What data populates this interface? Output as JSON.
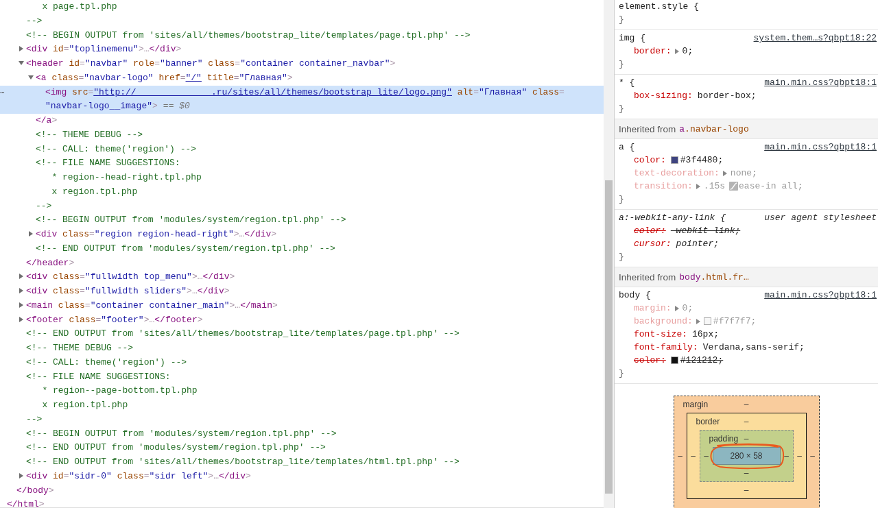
{
  "dom": [
    {
      "kind": "element",
      "close": "</html>",
      "children": [
        {
          "kind": "element",
          "close": "</body>",
          "children": [
            {
              "kind": "comment",
              "selected": false,
              "lines": [
                "   x page.tpl.php",
                "-->"
              ]
            },
            {
              "kind": "comment",
              "selected": false,
              "lines": [
                "<!-- BEGIN OUTPUT from 'sites/all/themes/bootstrap_lite/templates/page.tpl.php' -->"
              ]
            },
            {
              "kind": "element",
              "open": "<div id=\"toplinemenu\">…</div>",
              "expanded": false,
              "selected": false
            },
            {
              "kind": "element",
              "open": "<header id=\"navbar\" role=\"banner\" class=\"container container_navbar\">",
              "expanded": true,
              "selected": false,
              "close": "</header>",
              "children": [
                {
                  "kind": "element",
                  "open": [
                    {
                      "text": "<a class=\"navbar-logo\" href=",
                      "link": false
                    },
                    {
                      "text": "\"/\"",
                      "link": true
                    },
                    {
                      "text": " title=\"Главная\">",
                      "link": false
                    }
                  ],
                  "expanded": true,
                  "selected": false,
                  "close": "</a>",
                  "children": [
                    {
                      "kind": "element",
                      "open": [
                        {
                          "text": "<img src=",
                          "link": false
                        },
                        {
                          "text": "\"http://              .ru/sites/all/themes/bootstrap_lite/logo.png\"",
                          "link": true
                        },
                        {
                          "text": " alt=\"Главная\" class=",
                          "link": false
                        },
                        {
                          "text": "\"navbar-logo__image\">",
                          "link": false
                        }
                      ],
                      "selected": true,
                      "gutter": "⋯",
                      "reference": "== $0"
                    }
                  ]
                },
                {
                  "kind": "comment",
                  "selected": false,
                  "lines": [
                    "<!-- THEME DEBUG -->"
                  ]
                },
                {
                  "kind": "comment",
                  "selected": false,
                  "lines": [
                    "<!-- CALL: theme('region') -->"
                  ]
                },
                {
                  "kind": "comment",
                  "selected": false,
                  "lines": [
                    "<!-- FILE NAME SUGGESTIONS:",
                    "   * region--head-right.tpl.php",
                    "   x region.tpl.php",
                    "-->"
                  ]
                },
                {
                  "kind": "comment",
                  "selected": false,
                  "lines": [
                    "<!-- BEGIN OUTPUT from 'modules/system/region.tpl.php' -->"
                  ]
                },
                {
                  "kind": "element",
                  "open": "<div class=\"region region-head-right\">…</div>",
                  "expanded": false,
                  "selected": false
                },
                {
                  "kind": "comment",
                  "selected": false,
                  "lines": [
                    "<!-- END OUTPUT from 'modules/system/region.tpl.php' -->"
                  ]
                }
              ]
            },
            {
              "kind": "element",
              "open": "<div class=\"fullwidth top_menu\">…</div>",
              "expanded": false,
              "selected": false
            },
            {
              "kind": "element",
              "open": "<div class=\"fullwidth sliders\">…</div>",
              "expanded": false,
              "selected": false
            },
            {
              "kind": "element",
              "open": "<main class=\"container container_main\">…</main>",
              "expanded": false,
              "selected": false
            },
            {
              "kind": "element",
              "open": "<footer class=\"footer\">…</footer>",
              "expanded": false,
              "selected": false
            },
            {
              "kind": "comment",
              "selected": false,
              "lines": [
                "<!-- END OUTPUT from 'sites/all/themes/bootstrap_lite/templates/page.tpl.php' -->"
              ]
            },
            {
              "kind": "comment",
              "selected": false,
              "lines": [
                "<!-- THEME DEBUG -->"
              ]
            },
            {
              "kind": "comment",
              "selected": false,
              "lines": [
                "<!-- CALL: theme('region') -->"
              ]
            },
            {
              "kind": "comment",
              "selected": false,
              "lines": [
                "<!-- FILE NAME SUGGESTIONS:",
                "   * region--page-bottom.tpl.php",
                "   x region.tpl.php",
                "-->"
              ]
            },
            {
              "kind": "comment",
              "selected": false,
              "lines": [
                "<!-- BEGIN OUTPUT from 'modules/system/region.tpl.php' -->"
              ]
            },
            {
              "kind": "comment",
              "selected": false,
              "lines": [
                "<!-- END OUTPUT from 'modules/system/region.tpl.php' -->"
              ]
            },
            {
              "kind": "comment",
              "selected": false,
              "lines": [
                "<!-- END OUTPUT from 'sites/all/themes/bootstrap_lite/templates/html.tpl.php' -->"
              ]
            },
            {
              "kind": "element",
              "open": "<div id=\"sidr-0\" class=\"sidr left\">…</div>",
              "expanded": false,
              "selected": false
            }
          ]
        }
      ]
    }
  ],
  "styles": [
    {
      "kind": "rule",
      "selector": "element.style {",
      "close": "}"
    },
    {
      "kind": "rule",
      "selector": "img {",
      "source": "system.them…s?qbpt18:22",
      "user_agent": false,
      "close": "}",
      "properties": [
        {
          "name": "border:",
          "value": "0;",
          "expandable": true,
          "inactive": false,
          "overridden": false
        }
      ]
    },
    {
      "kind": "rule",
      "selector": "* {",
      "source": "main.min.css?qbpt18:1",
      "user_agent": false,
      "close": "}",
      "properties": [
        {
          "name": "box-sizing:",
          "value": "border-box;",
          "expandable": false,
          "inactive": false,
          "overridden": false
        }
      ]
    },
    {
      "kind": "inherited",
      "label": "Inherited from",
      "from": "a.navbar-logo"
    },
    {
      "kind": "rule",
      "selector": "a {",
      "source": "main.min.css?qbpt18:1",
      "user_agent": false,
      "close": "}",
      "properties": [
        {
          "name": "color:",
          "value": "#3f4480;",
          "swatch": true,
          "expandable": false,
          "inactive": false,
          "overridden": false
        },
        {
          "name": "text-decoration:",
          "value": "none;",
          "expandable": true,
          "inactive": true,
          "overridden": false
        },
        {
          "name": "transition:",
          "value": ".15s",
          "easing": "ease-in all;",
          "expandable": true,
          "inactive": true,
          "overridden": false
        }
      ]
    },
    {
      "kind": "rule",
      "selector": "a:-webkit-any-link {",
      "source": "user agent stylesheet",
      "user_agent": true,
      "close": "}",
      "properties": [
        {
          "name": "color:",
          "value": "-webkit-link;",
          "expandable": false,
          "inactive": false,
          "overridden": true
        },
        {
          "name": "cursor:",
          "value": "pointer;",
          "expandable": false,
          "inactive": false,
          "overridden": false
        }
      ]
    },
    {
      "kind": "inherited",
      "label": "Inherited from",
      "from": "body.html.fr…"
    },
    {
      "kind": "rule",
      "selector": "body {",
      "source": "main.min.css?qbpt18:1",
      "user_agent": false,
      "close": "}",
      "properties": [
        {
          "name": "margin:",
          "value": "0;",
          "expandable": true,
          "inactive": true,
          "overridden": false
        },
        {
          "name": "background:",
          "value": "#f7f7f7;",
          "swatch": true,
          "expandable": true,
          "inactive": true,
          "overridden": false
        },
        {
          "name": "font-size:",
          "value": "16px;",
          "expandable": false,
          "inactive": false,
          "overridden": false
        },
        {
          "name": "font-family:",
          "value": "Verdana,sans-serif;",
          "expandable": false,
          "inactive": false,
          "overridden": false
        },
        {
          "name": "color:",
          "value": "#121212;",
          "swatch": true,
          "expandable": false,
          "inactive": false,
          "overridden": true
        }
      ]
    }
  ],
  "box_model": {
    "margin": {
      "label": "margin",
      "top": "–",
      "left": "–",
      "right": "–"
    },
    "border": {
      "label": "border",
      "top": "–",
      "left": "–",
      "right": "–",
      "bottom": "–"
    },
    "padding": {
      "label": "padding",
      "top": "–",
      "left": "–",
      "right": "–",
      "bottom": "–"
    },
    "content": "280 × 58",
    "annotation": {
      "kind": "freehand-circle"
    }
  }
}
